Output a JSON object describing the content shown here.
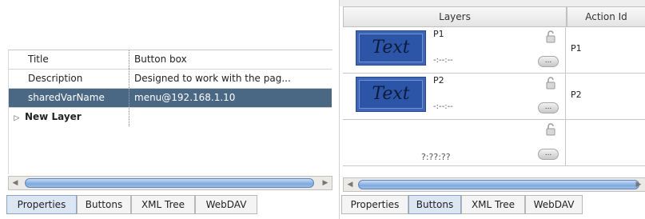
{
  "left_panel": {
    "properties": [
      {
        "name": "Title",
        "value": "Button box"
      },
      {
        "name": "Description",
        "value": "Designed to work with the pag..."
      },
      {
        "name": "sharedVarName",
        "value": "menu@192.168.1.10"
      }
    ],
    "new_layer_label": "New Layer",
    "tabs": [
      "Properties",
      "Buttons",
      "XML Tree",
      "WebDAV"
    ],
    "active_tab": "Properties"
  },
  "right_panel": {
    "columns": [
      "Layers",
      "Action Id"
    ],
    "rows": [
      {
        "thumbnail_text": "Text",
        "layer": "P1",
        "time": "-:--:--",
        "action_id": "P1",
        "more": "..."
      },
      {
        "thumbnail_text": "Text",
        "layer": "P2",
        "time": "-:--:--",
        "action_id": "P2",
        "more": "..."
      },
      {
        "thumbnail_text": "",
        "layer": "",
        "time": "?:??:??",
        "action_id": "",
        "more": "..."
      }
    ],
    "tabs": [
      "Properties",
      "Buttons",
      "XML Tree",
      "WebDAV"
    ],
    "active_tab": "Buttons"
  },
  "colors": {
    "selected_row": "#4a6784",
    "active_tab": "#dbe6f2",
    "thumbnail": "#3e66b5",
    "scroll_thumb": "#7fa9dd"
  }
}
